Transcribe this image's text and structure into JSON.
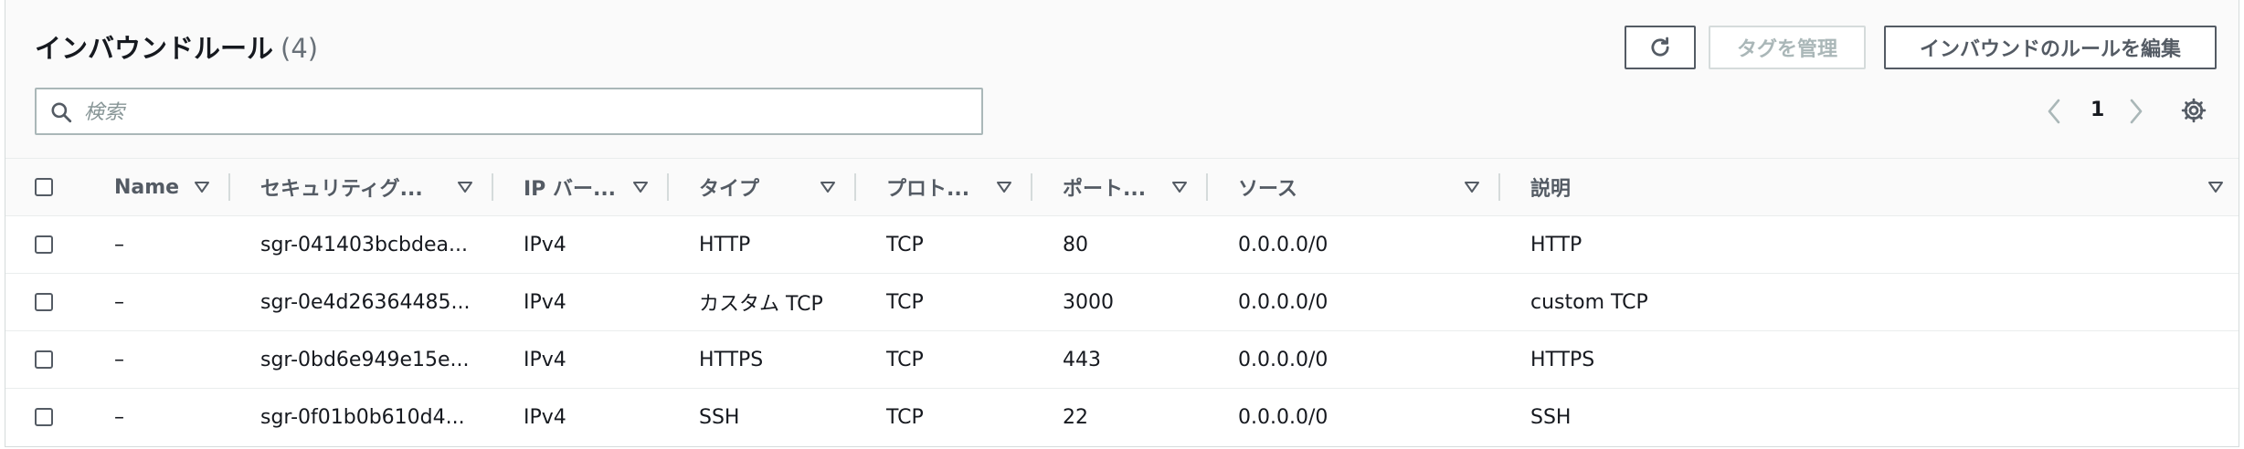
{
  "header": {
    "title": "インバウンドルール",
    "count": "(4)",
    "manage_tags_label": "タグを管理",
    "edit_rules_label": "インバウンドのルールを編集"
  },
  "search": {
    "placeholder": "検索",
    "value": ""
  },
  "pagination": {
    "current_page": "1"
  },
  "columns": [
    "Name",
    "セキュリティグ...",
    "IP バー...",
    "タイプ",
    "プロト...",
    "ポート...",
    "ソース",
    "説明"
  ],
  "rows": [
    {
      "name": "–",
      "sg_rule_id": "sgr-041403bcbdea...",
      "ip_version": "IPv4",
      "type": "HTTP",
      "protocol": "TCP",
      "port": "80",
      "source": "0.0.0.0/0",
      "description": "HTTP"
    },
    {
      "name": "–",
      "sg_rule_id": "sgr-0e4d26364485...",
      "ip_version": "IPv4",
      "type": "カスタム TCP",
      "protocol": "TCP",
      "port": "3000",
      "source": "0.0.0.0/0",
      "description": "custom TCP"
    },
    {
      "name": "–",
      "sg_rule_id": "sgr-0bd6e949e15e...",
      "ip_version": "IPv4",
      "type": "HTTPS",
      "protocol": "TCP",
      "port": "443",
      "source": "0.0.0.0/0",
      "description": "HTTPS"
    },
    {
      "name": "–",
      "sg_rule_id": "sgr-0f01b0b610d4...",
      "ip_version": "IPv4",
      "type": "SSH",
      "protocol": "TCP",
      "port": "22",
      "source": "0.0.0.0/0",
      "description": "SSH"
    }
  ],
  "icons": {
    "refresh": "refresh-icon",
    "search": "search-icon",
    "prev": "chevron-left-icon",
    "next": "chevron-right-icon",
    "settings": "gear-icon",
    "sort": "caret-down-icon"
  },
  "colors": {
    "text": "#16191f",
    "muted": "#545b64",
    "border": "#d5dbdb",
    "header_bg": "#fafafa"
  }
}
